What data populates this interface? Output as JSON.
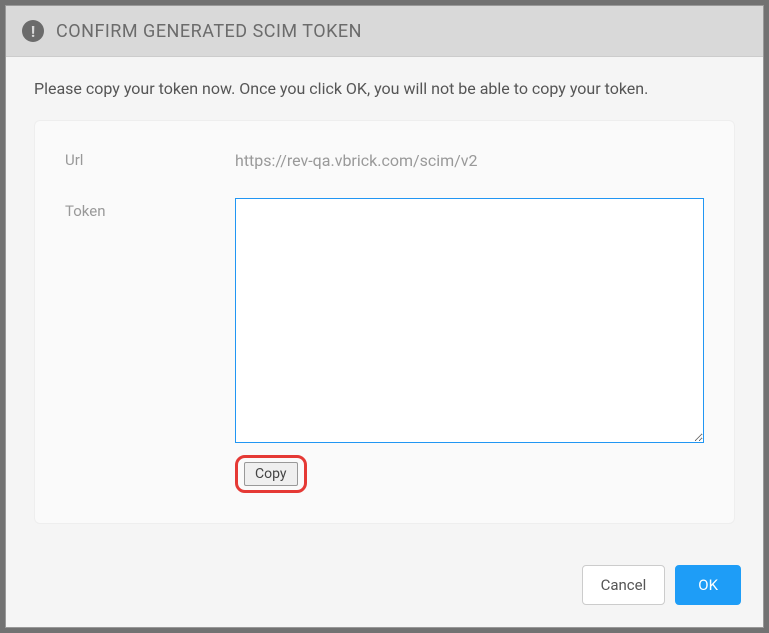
{
  "modal": {
    "title": "CONFIRM GENERATED SCIM TOKEN",
    "instruction": "Please copy your token now. Once you click OK, you will not be able to copy your token.",
    "fields": {
      "url": {
        "label": "Url",
        "value": "https://rev-qa.vbrick.com/scim/v2"
      },
      "token": {
        "label": "Token",
        "value": ""
      }
    },
    "buttons": {
      "copy": "Copy",
      "cancel": "Cancel",
      "ok": "OK"
    }
  }
}
